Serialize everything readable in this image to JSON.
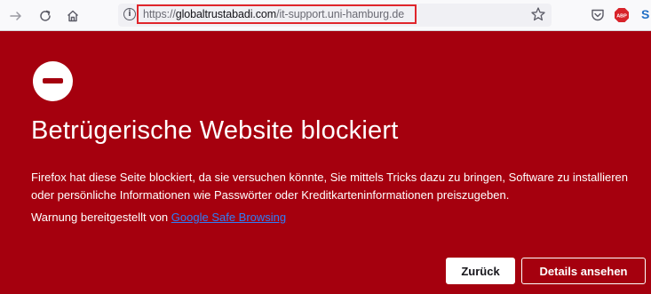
{
  "browser": {
    "url_scheme": "https://",
    "url_domain": "globaltrustabadi.com",
    "url_path": "/it-support.uni-hamburg.de",
    "info_icon_glyph": "i",
    "extension_s_label": "S",
    "extension_abp_label": "ABP"
  },
  "page": {
    "title": "Betrügerische Website blockiert",
    "description": "Firefox hat diese Seite blockiert, da sie versuchen könnte, Sie mittels Tricks dazu zu bringen, Software zu installieren oder persönliche Informationen wie Passwörter oder Kreditkarteninformationen preiszugeben.",
    "warning_prefix": "Warnung bereitgestellt von ",
    "warning_link": "Google Safe Browsing",
    "back_button": "Zurück",
    "details_button": "Details ansehen"
  },
  "colors": {
    "page_background": "#a5000e",
    "url_highlight": "#e0252b",
    "link": "#2f7df6"
  },
  "icons": [
    "forward-icon",
    "reload-icon",
    "home-icon",
    "info-icon",
    "bookmark-star-icon",
    "pocket-icon",
    "adblock-plus-icon",
    "extension-s-icon",
    "stop-icon"
  ]
}
